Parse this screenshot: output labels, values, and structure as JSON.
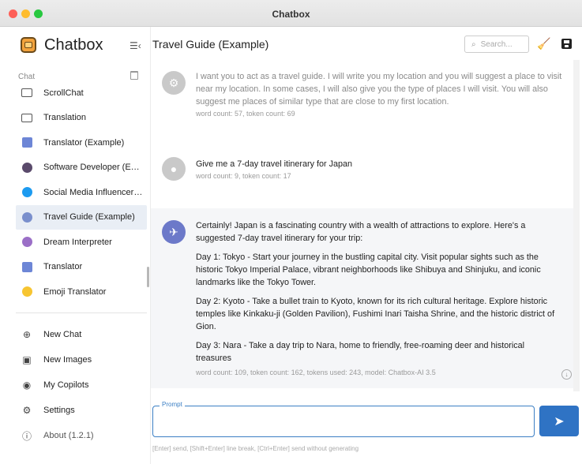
{
  "window": {
    "title": "Chatbox"
  },
  "sidebar": {
    "brand": "Chatbox",
    "section_label": "Chat",
    "chats": [
      {
        "label": "ScrollChat",
        "icon": "chat-bubble-icon",
        "active": false
      },
      {
        "label": "Translation",
        "icon": "chat-bubble-icon",
        "active": false
      },
      {
        "label": "Translator (Example)",
        "icon": "translator-avatar-icon",
        "active": false
      },
      {
        "label": "Software Developer (E…",
        "icon": "developer-avatar-icon",
        "active": false
      },
      {
        "label": "Social Media Influencer…",
        "icon": "twitter-avatar-icon",
        "active": false
      },
      {
        "label": "Travel Guide (Example)",
        "icon": "globe-avatar-icon",
        "active": true
      },
      {
        "label": "Dream Interpreter",
        "icon": "dream-avatar-icon",
        "active": false
      },
      {
        "label": "Translator",
        "icon": "translator-avatar-icon",
        "active": false
      },
      {
        "label": "Emoji Translator",
        "icon": "emoji-avatar-icon",
        "active": false
      }
    ],
    "bottom": {
      "new_chat": "New Chat",
      "new_images": "New Images",
      "my_copilots": "My Copilots",
      "settings": "Settings",
      "about": "About (1.2.1)"
    }
  },
  "main": {
    "title": "Travel Guide (Example)",
    "search_placeholder": "Search...",
    "messages": {
      "system": {
        "text": "I want you to act as a travel guide. I will write you my location and you will suggest a place to visit near my location. In some cases, I will also give you the type of places I will visit. You will also suggest me places of similar type that are close to my first location.",
        "meta": "word count: 57, token count: 69"
      },
      "user": {
        "text": "Give me a 7-day travel itinerary for Japan",
        "meta": "word count: 9, token count: 17"
      },
      "assistant": {
        "p1": "Certainly! Japan is a fascinating country with a wealth of attractions to explore. Here's a suggested 7-day travel itinerary for your trip:",
        "p2": "Day 1: Tokyo - Start your journey in the bustling capital city. Visit popular sights such as the historic Tokyo Imperial Palace, vibrant neighborhoods like Shibuya and Shinjuku, and iconic landmarks like the Tokyo Tower.",
        "p3": "Day 2: Kyoto - Take a bullet train to Kyoto, known for its rich cultural heritage. Explore historic temples like Kinkaku-ji (Golden Pavilion), Fushimi Inari Taisha Shrine, and the historic district of Gion.",
        "p4": "Day 3: Nara - Take a day trip to Nara, home to friendly, free-roaming deer and historical treasures",
        "meta": "word count: 109, token count: 162, tokens used: 243, model: Chatbox-AI 3.5"
      }
    },
    "prompt": {
      "label": "Prompt",
      "value": "",
      "hint": "[Enter] send, [Shift+Enter] line break, [Ctrl+Enter] send without generating"
    }
  },
  "colors": {
    "accent": "#2f73c4",
    "active_item_bg": "#e9eef5",
    "assistant_bg": "#f5f6f8"
  }
}
